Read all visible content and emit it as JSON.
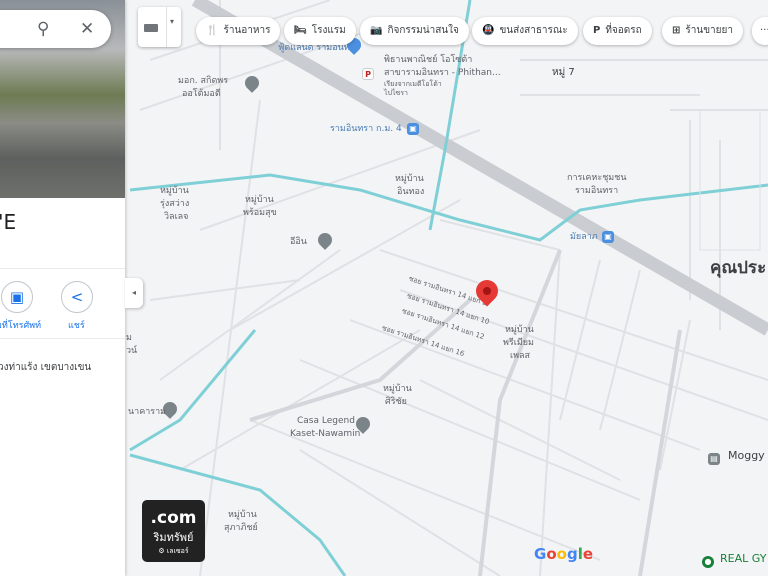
{
  "search": {
    "search_icon": "search-icon",
    "close_icon": "close-icon"
  },
  "place": {
    "title": "'E",
    "address": "วงท่าแร้ง เขตบางเขน",
    "actions": [
      {
        "label": "มที่โทรศัพท์",
        "icon": "phone-icon"
      },
      {
        "label": "แชร์",
        "icon": "share-icon"
      }
    ]
  },
  "chips": [
    {
      "icon": "restaurant-icon",
      "glyph": "🍴",
      "label": "ร้านอาหาร"
    },
    {
      "icon": "hotel-icon",
      "glyph": "🛏",
      "label": "โรงแรม"
    },
    {
      "icon": "camera-icon",
      "glyph": "📷",
      "label": "กิจกรรมน่าสนใจ"
    },
    {
      "icon": "transit-icon",
      "glyph": "🚇",
      "label": "ขนส่งสาธารณะ"
    },
    {
      "icon": "parking-icon",
      "glyph": "P",
      "label": "ที่จอดรถ"
    },
    {
      "icon": "pharmacy-icon",
      "glyph": "⊞",
      "label": "ร้านขายยา"
    },
    {
      "icon": "more-icon",
      "glyph": "···",
      "label": ""
    }
  ],
  "map": {
    "labels": {
      "foodland": "ฟู้ดแลนด์ รามอินทรา",
      "auto1": "มอก. สกิดพร",
      "auto2": "ออโต้มอตี",
      "phithan1": "พิธานพาณิชย์ โอโซต้า",
      "phithan2": "สาขารามอินทรา - Phithan...",
      "phithan3": "เรียงจากเมตีโอโต้า",
      "phithan4": "ไปไซรา",
      "moo7": "หมู่ 7",
      "station_km4": "รามอินทรา ก.ม. 4",
      "intong1": "หมู่บ้าน",
      "intong2": "อินทอง",
      "rungsawang1": "หมู่บ้าน",
      "rungsawang2": "รุ่งสว่าง",
      "rungsawang3": "วิลเลจ",
      "promsuk1": "หมู่บ้าน",
      "promsuk2": "พร้อมสุข",
      "kheha1": "การเคหะชุมชน",
      "kheha2": "รามอินทรา",
      "station_mailap": "มัยลาภ",
      "ein": "อีอิน",
      "khunpra": "คุณประ",
      "premium1": "หมู่บ้าน",
      "premium2": "พรีเมียม",
      "premium3": "เพลส",
      "sirichai1": "หมู่บ้าน",
      "sirichai2": "ศิริชัย",
      "casa1": "Casa Legend",
      "casa2": "Kaset-Nawamin",
      "moggy": "Moggy",
      "supa1": "หมู่บ้าน",
      "supa2": "สุภาภิชย์",
      "realgym": "REAL GY",
      "soi1": "ซอย รามอินทรา 14 แยก 2",
      "soi2": "ซอย รามอินทรา 14 แยก 10",
      "soi3": "ซอย รามอินทรา 14 แยก 12",
      "soi4": "ซอย รามอินทรา 14 แยก 16",
      "left1": "ม",
      "left2": "วน์",
      "left3": "นาคาราม"
    },
    "google_logo": "Google",
    "watermark": {
      "line1": ".com",
      "line2": "ริมทรัพย์",
      "line3": "เลเซอร์"
    },
    "pin_color": "#e53935",
    "highway_color": "#c9cdd2",
    "canal_color": "#7fd0d6"
  },
  "layer_button": {
    "icon": "layers-icon"
  },
  "collapse_button": {
    "glyph": "◂"
  }
}
